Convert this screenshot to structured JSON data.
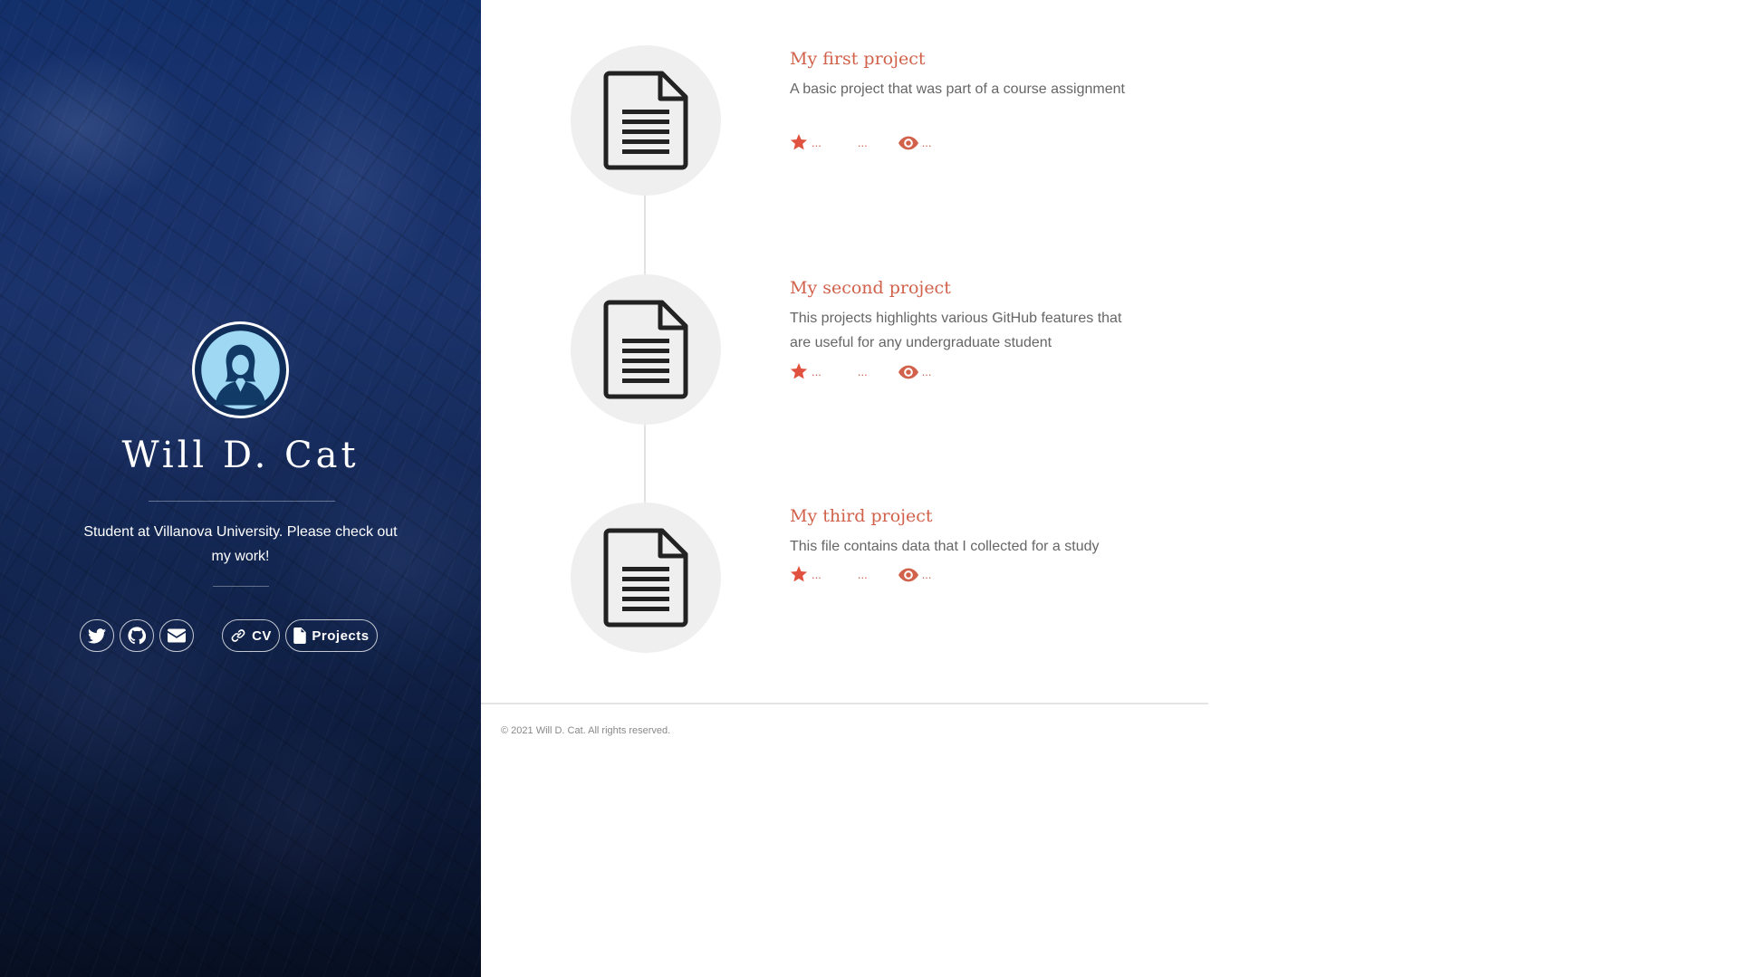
{
  "profile": {
    "name": "Will D. Cat",
    "bio": "Student at Villanova University. Please check out my work!"
  },
  "social_links": {
    "twitter_icon": "twitter-icon",
    "github_icon": "github-icon",
    "email_icon": "envelope-icon",
    "cv_label": "CV",
    "cv_icon": "link-icon",
    "projects_label": "Projects",
    "projects_icon": "code-file-icon"
  },
  "projects": [
    {
      "title": "My first project",
      "description": "A basic project that was part of a course assignment",
      "stars": "...",
      "forks": "...",
      "watchers": "...",
      "icon": "document-icon"
    },
    {
      "title": "My second project",
      "description": "This projects highlights various GitHub features that are useful for any undergraduate student",
      "stars": "...",
      "forks": "...",
      "watchers": "...",
      "icon": "document-icon"
    },
    {
      "title": "My third project",
      "description": "This file contains data that I collected for a study",
      "stars": "...",
      "forks": "...",
      "watchers": "...",
      "icon": "document-icon"
    }
  ],
  "footer": {
    "copyright": "© 2021 Will D. Cat. All rights reserved."
  },
  "colors": {
    "accent": "#d1614a",
    "sidebar": "#14306b",
    "icon_bg": "#efefef"
  }
}
